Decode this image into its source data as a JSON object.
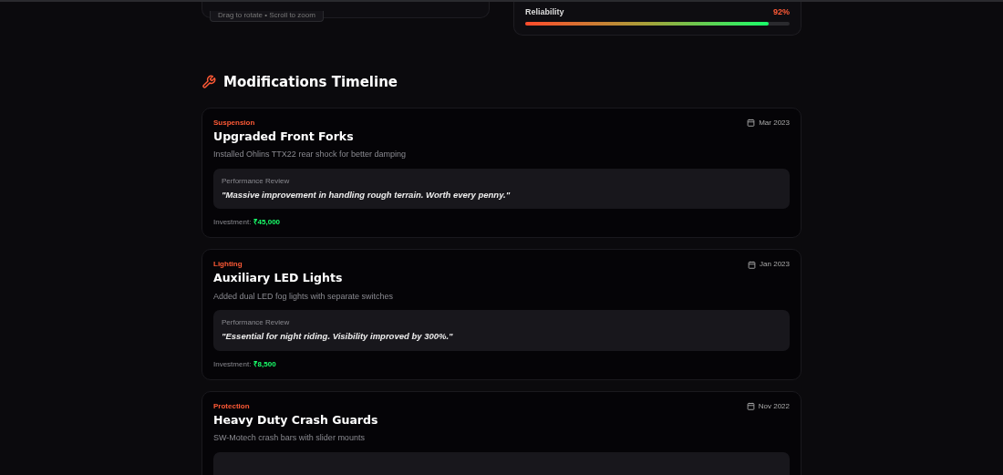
{
  "viewer_hint": "Drag to rotate • Scroll to zoom",
  "reliability": {
    "label": "Reliability",
    "reading": "92%",
    "level": 0.92
  },
  "section_title": "Modifications Timeline",
  "mods": [
    {
      "category": "Suspension",
      "title": "Upgraded Front Forks",
      "date": "Mar 2023",
      "description": "Installed Ohlins TTX22 rear shock for better damping",
      "review_label": "Performance Review",
      "review": "\"Massive improvement in handling rough terrain. Worth every penny.\"",
      "investment_label": "Investment:",
      "investment": "₹45,000"
    },
    {
      "category": "Lighting",
      "title": "Auxiliary LED Lights",
      "date": "Jan 2023",
      "description": "Added dual LED fog lights with separate switches",
      "review_label": "Performance Review",
      "review": "\"Essential for night riding. Visibility improved by 300%.\"",
      "investment_label": "Investment:",
      "investment": "₹8,500"
    },
    {
      "category": "Protection",
      "title": "Heavy Duty Crash Guards",
      "date": "Nov 2022",
      "description": "SW-Motech crash bars with slider mounts"
    }
  ]
}
